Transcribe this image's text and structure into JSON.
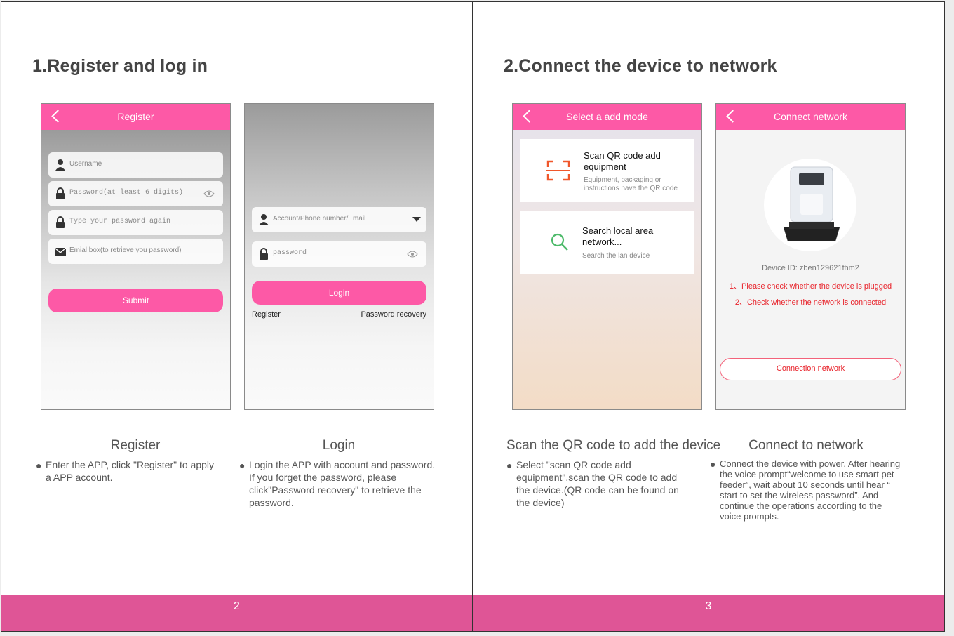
{
  "left_page": {
    "heading": "1.Register and log in",
    "page_number": "2",
    "register_screen": {
      "title": "Register",
      "username_placeholder": "Username",
      "password_placeholder": "Password(at least 6 digits)",
      "password_again_placeholder": "Type your password again",
      "email_placeholder": "Emial box(to retrieve you password)",
      "submit_label": "Submit"
    },
    "login_screen": {
      "account_placeholder": "Account/Phone number/Email",
      "password_placeholder": "password",
      "login_label": "Login",
      "register_link": "Register",
      "recovery_link": "Password recovery"
    },
    "register_caption": {
      "title": "Register",
      "body": "Enter the APP, click \"Register\" to apply a APP account."
    },
    "login_caption": {
      "title": "Login",
      "body": "Login the APP with account and password. If you forget the password, please click\"Password recovery\" to retrieve the password."
    }
  },
  "right_page": {
    "heading": "2.Connect the device to network",
    "page_number": "3",
    "mode_screen": {
      "title": "Select a add mode",
      "qr_title": "Scan QR code add equipment",
      "qr_desc": "Equipment, packaging or instructions have the QR code",
      "lan_title": "Search local area network...",
      "lan_desc": "Search the lan device"
    },
    "connect_screen": {
      "title": "Connect network",
      "device_id": "Device ID: zben129621fhm2",
      "check1": "1、Please check whether the device is plugged",
      "check2": "2、Check whether the network is connected",
      "button_label": "Connection network"
    },
    "scan_caption": {
      "title": "Scan the QR code to add the device",
      "body": "Select \"scan QR code add equipment\",scan the QR code to add the device.(QR code can be found on the device)"
    },
    "connect_caption": {
      "title": "Connect to network",
      "body": "Connect the device with power. After hearing the voice prompt“welcome to use smart pet feeder”, wait about 10 seconds until hear “ start to set the wireless password”. And continue the operations according to the voice prompts."
    }
  },
  "colors": {
    "accent": "#fd59a6",
    "footer": "#df5596",
    "warning": "#e8222a",
    "qr_icon": "#f0572b",
    "search_icon": "#4dba6a"
  }
}
